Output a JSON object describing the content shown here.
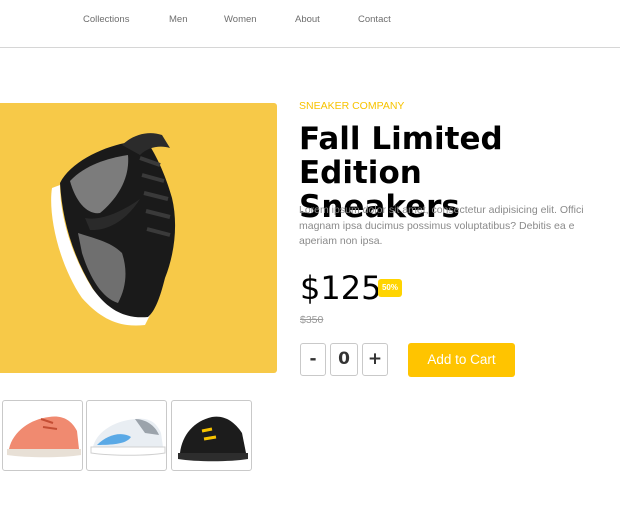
{
  "nav": {
    "items": [
      "Collections",
      "Men",
      "Women",
      "About",
      "Contact"
    ]
  },
  "product": {
    "brand": "SNEAKER COMPANY",
    "title_line1": "Fall Limited Edition",
    "title_line2": "Sneakers",
    "description_lines": [
      "Lorem ipsum dolor sit amet, consectetur adipisicing elit. Offici",
      "magnam ipsa ducimus possimus voluptatibus? Debitis ea e",
      "aperiam non ipsa."
    ],
    "price": "$125",
    "discount_badge": "50%",
    "old_price": "$350",
    "quantity": "0",
    "minus_label": "-",
    "plus_label": "+",
    "add_to_cart_label": "Add to Cart"
  },
  "images": {
    "main": "black-grey-high-top-sneaker",
    "thumbnails": [
      "coral-sneaker",
      "blue-white-sneaker",
      "black-yellow-sneaker"
    ]
  },
  "colors": {
    "accent": "#ffc400",
    "main_bg": "#f7c948",
    "brand_text": "#f7c300"
  }
}
